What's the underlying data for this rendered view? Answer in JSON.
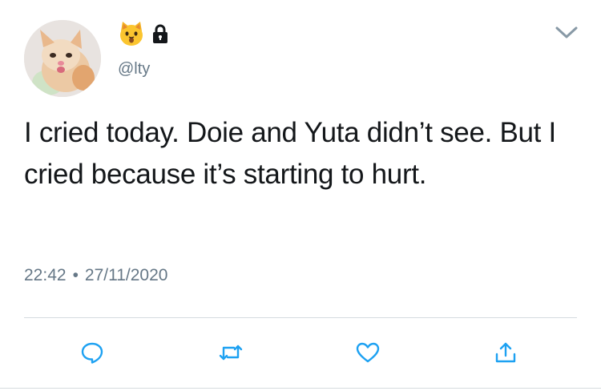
{
  "user": {
    "display_icons": [
      "cat-face-emoji-icon",
      "lock-icon"
    ],
    "handle": "@lty",
    "avatar": "crying-cat-avatar"
  },
  "tweet": {
    "text": "I cried today. Doie and Yuta didn’t see. But I cried because it’s starting to hurt.",
    "time": "22:42",
    "separator": "•",
    "date": "27/11/2020"
  },
  "actions": [
    "reply-icon",
    "retweet-icon",
    "like-icon",
    "share-icon"
  ],
  "colors": {
    "text": "#14171a",
    "secondary": "#657786",
    "accent": "#1da1f2",
    "divider": "#d6dbdf"
  }
}
